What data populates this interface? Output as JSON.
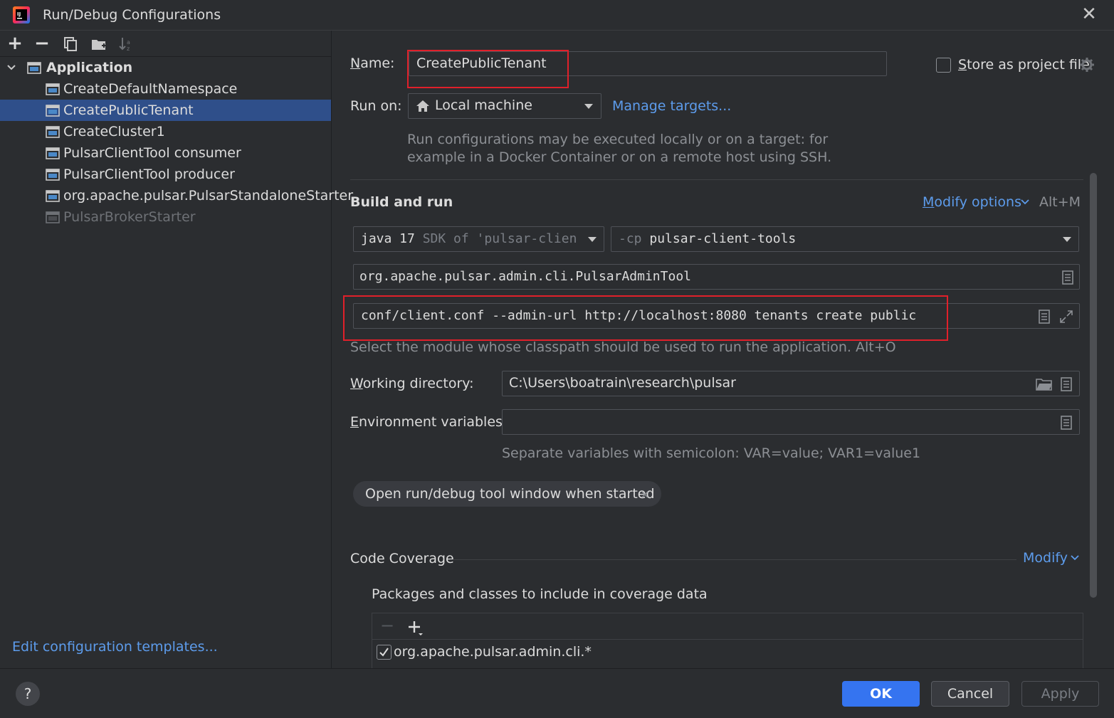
{
  "window": {
    "title": "Run/Debug Configurations",
    "close": "✕"
  },
  "toolbar": {
    "add": "+",
    "remove": "−"
  },
  "tree": {
    "group": "Application",
    "items": [
      {
        "label": "CreateDefaultNamespace",
        "selected": false,
        "disabled": false
      },
      {
        "label": "CreatePublicTenant",
        "selected": true,
        "disabled": false
      },
      {
        "label": "CreateCluster1",
        "selected": false,
        "disabled": false
      },
      {
        "label": "PulsarClientTool consumer",
        "selected": false,
        "disabled": false
      },
      {
        "label": "PulsarClientTool producer",
        "selected": false,
        "disabled": false
      },
      {
        "label": "org.apache.pulsar.PulsarStandaloneStarter",
        "selected": false,
        "disabled": false
      },
      {
        "label": "PulsarBrokerStarter",
        "selected": false,
        "disabled": true
      }
    ],
    "edit_templates": "Edit configuration templates..."
  },
  "form": {
    "name_label": "Name:",
    "name_value": "CreatePublicTenant",
    "store_label": "Store as project file",
    "store_checked": false,
    "runon_label": "Run on:",
    "runon_value": "Local machine",
    "manage_targets": "Manage targets...",
    "runon_hint_1": "Run configurations may be executed locally or on a target: for",
    "runon_hint_2": "example in a Docker Container or on a remote host using SSH.",
    "build_run": "Build and run",
    "modify_options": "Modify options",
    "modify_shortcut": "Alt+M",
    "jdk_main": "java 17",
    "jdk_hint": "SDK of 'pulsar-clien",
    "cp_prefix": "-cp",
    "cp_value": "pulsar-client-tools",
    "main_class": "org.apache.pulsar.admin.cli.PulsarAdminTool",
    "program_args": "conf/client.conf --admin-url http://localhost:8080 tenants create public",
    "module_hint": "Select the module whose classpath should be used to run the application. Alt+O",
    "workdir_label": "Working directory:",
    "workdir_value": "C:\\Users\\boatrain\\research\\pulsar",
    "env_label": "Environment variables:",
    "env_value": "",
    "env_hint": "Separate variables with semicolon: VAR=value; VAR1=value1",
    "open_tool_window": "Open run/debug tool window when started",
    "code_coverage": "Code Coverage",
    "modify": "Modify",
    "packages_label": "Packages and classes to include in coverage data",
    "coverage_item": "org.apache.pulsar.admin.cli.*",
    "coverage_item_checked": true
  },
  "buttons": {
    "help": "?",
    "ok": "OK",
    "cancel": "Cancel",
    "apply": "Apply"
  },
  "colors": {
    "background": "#2b2d30",
    "selection": "#2f4f8a",
    "link": "#5d9cec",
    "primary_button": "#3574f0",
    "highlight_box": "#e0202a"
  }
}
